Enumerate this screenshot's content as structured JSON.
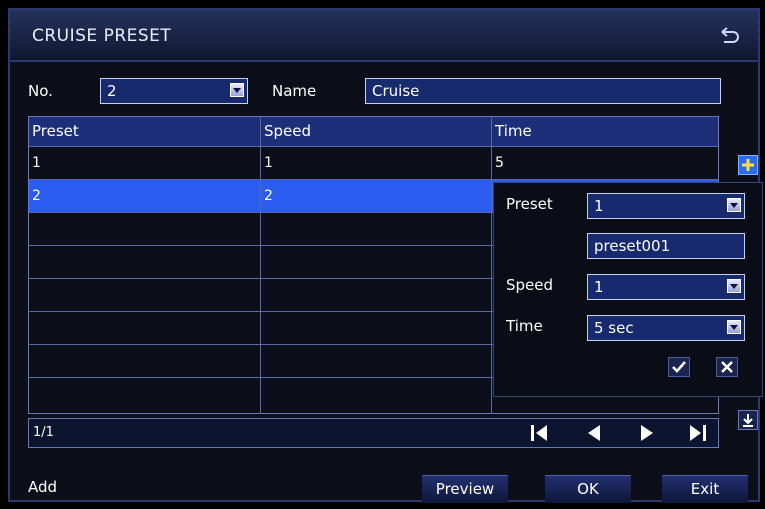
{
  "title": "CRUISE PRESET",
  "form": {
    "no_label": "No.",
    "no_value": "2",
    "name_label": "Name",
    "name_value": "Cruise"
  },
  "table": {
    "headers": [
      "Preset",
      "Speed",
      "Time"
    ],
    "rows": [
      [
        "1",
        "1",
        "5"
      ],
      [
        "2",
        "2",
        ""
      ],
      [
        "",
        "",
        ""
      ],
      [
        "",
        "",
        ""
      ],
      [
        "",
        "",
        ""
      ],
      [
        "",
        "",
        ""
      ],
      [
        "",
        "",
        ""
      ],
      [
        "",
        "",
        ""
      ]
    ],
    "selected_row_index": 1
  },
  "pager": {
    "page": "1/1"
  },
  "popup": {
    "preset_label": "Preset",
    "preset_value": "1",
    "preset_name": "preset001",
    "speed_label": "Speed",
    "speed_value": "1",
    "time_label": "Time",
    "time_value": "5 sec"
  },
  "footer": {
    "status": "Add",
    "preview": "Preview",
    "ok": "OK",
    "exit": "Exit"
  },
  "colors": {
    "selected_row": "#2a5cf0",
    "field_bg": "#172a6e",
    "accent_add": "#2a6cf0"
  }
}
